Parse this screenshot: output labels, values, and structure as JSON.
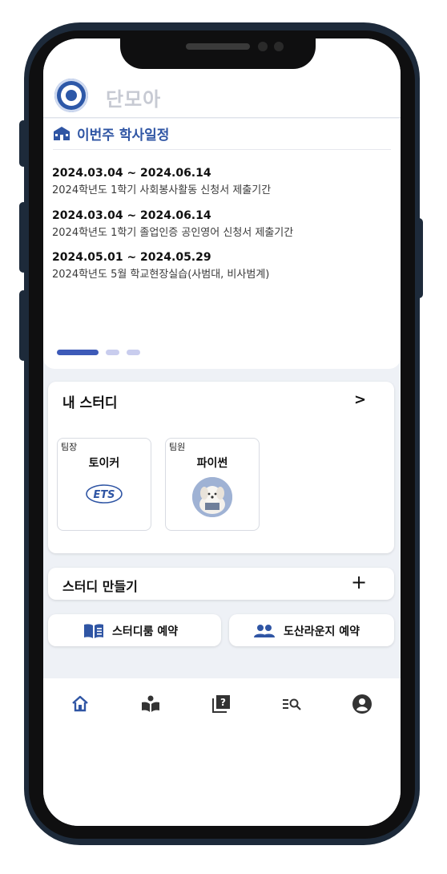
{
  "app": {
    "name": "단모아"
  },
  "schedule": {
    "title": "이번주 학사일정",
    "events": [
      {
        "date": "2024.03.04 ~ 2024.06.14",
        "desc": "2024학년도 1학기 사회봉사활동 신청서 제출기간"
      },
      {
        "date": "2024.03.04 ~ 2024.06.14",
        "desc": "2024학년도 1학기 졸업인증 공인영어 신청서 제출기간"
      },
      {
        "date": "2024.05.01 ~ 2024.05.29",
        "desc": "2024학년도 5월 학교현장실습(사범대, 비사범계)"
      }
    ],
    "page_indicator": {
      "pages": 3,
      "active": 1
    }
  },
  "my_study": {
    "title": "내 스터디",
    "chevron": ">",
    "items": [
      {
        "role": "팀장",
        "name": "토이커",
        "logo_text": "ETS"
      },
      {
        "role": "팀원",
        "name": "파이썬",
        "image": "puppy-avatar"
      }
    ]
  },
  "create_study": {
    "label": "스터디 만들기",
    "icon": "+"
  },
  "reservations": {
    "study_room": {
      "label": "스터디룸 예약",
      "icon": "book-icon"
    },
    "lounge": {
      "label": "도산라운지 예약",
      "icon": "people-icon"
    }
  },
  "nav": {
    "items": [
      {
        "name": "home",
        "icon": "home-icon",
        "active": true
      },
      {
        "name": "reading",
        "icon": "reader-icon"
      },
      {
        "name": "question",
        "icon": "question-book-icon"
      },
      {
        "name": "search-list",
        "icon": "search-list-icon"
      },
      {
        "name": "profile",
        "icon": "account-icon"
      }
    ]
  },
  "colors": {
    "primary": "#2f55a4",
    "accent": "#3d5ab8",
    "frame": "#1d2a3a",
    "background": "#eef1f6"
  }
}
